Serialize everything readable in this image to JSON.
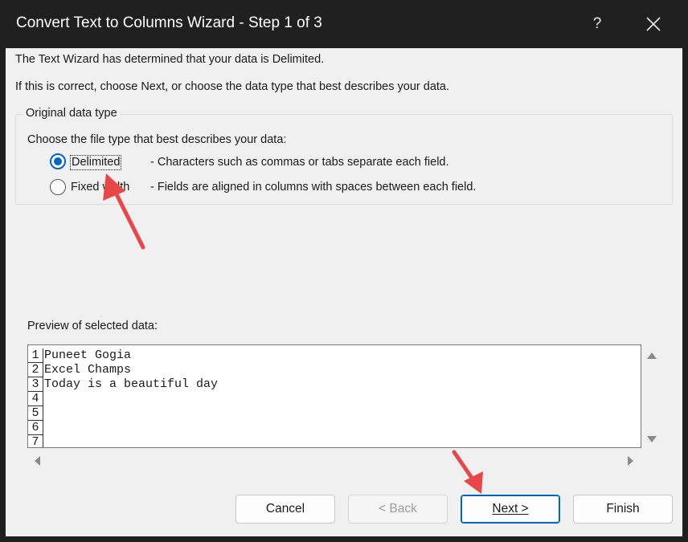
{
  "window": {
    "title": "Convert Text to Columns Wizard - Step 1 of 3",
    "help_label": "?"
  },
  "intro": {
    "line1": "The Text Wizard has determined that your data is Delimited.",
    "line2": "If this is correct, choose Next, or choose the data type that best describes your data."
  },
  "original_data_type": {
    "legend": "Original data type",
    "prompt": "Choose the file type that best describes your data:",
    "options": [
      {
        "label": "Delimited",
        "description": "- Characters such as commas or tabs separate each field.",
        "selected": true
      },
      {
        "label": "Fixed width",
        "description": "- Fields are aligned in columns with spaces between each field.",
        "selected": false
      }
    ]
  },
  "preview": {
    "label": "Preview of selected data:",
    "rows": [
      {
        "num": "1",
        "text": "Puneet Gogia"
      },
      {
        "num": "2",
        "text": "Excel Champs"
      },
      {
        "num": "3",
        "text": "Today is a beautiful day"
      },
      {
        "num": "4",
        "text": ""
      },
      {
        "num": "5",
        "text": ""
      },
      {
        "num": "6",
        "text": ""
      },
      {
        "num": "7",
        "text": ""
      }
    ]
  },
  "buttons": {
    "cancel": "Cancel",
    "back": "< Back",
    "next": "Next >",
    "finish": "Finish"
  },
  "colors": {
    "titlebar": "#202020",
    "accent": "#0067c0",
    "annotation_arrow": "#e8474a"
  }
}
